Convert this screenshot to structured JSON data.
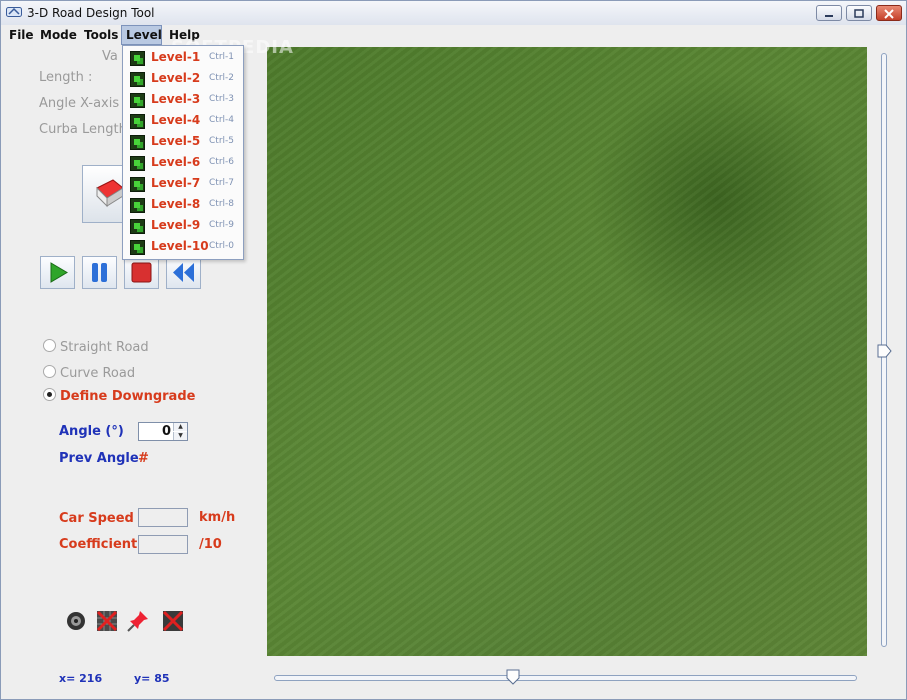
{
  "window": {
    "title": "3-D Road Design Tool"
  },
  "menu": {
    "items": [
      "File",
      "Mode",
      "Tools",
      "Level",
      "Help"
    ],
    "active": "Level"
  },
  "level_menu": [
    {
      "label": "Level-1",
      "shortcut": "Ctrl-1"
    },
    {
      "label": "Level-2",
      "shortcut": "Ctrl-2"
    },
    {
      "label": "Level-3",
      "shortcut": "Ctrl-3"
    },
    {
      "label": "Level-4",
      "shortcut": "Ctrl-4"
    },
    {
      "label": "Level-5",
      "shortcut": "Ctrl-5"
    },
    {
      "label": "Level-6",
      "shortcut": "Ctrl-6"
    },
    {
      "label": "Level-7",
      "shortcut": "Ctrl-7"
    },
    {
      "label": "Level-8",
      "shortcut": "Ctrl-8"
    },
    {
      "label": "Level-9",
      "shortcut": "Ctrl-9"
    },
    {
      "label": "Level-10",
      "shortcut": "Ctrl-0"
    }
  ],
  "left_panel": {
    "values_label": "Va",
    "length_label": "Length :",
    "angle_x_label": "Angle X-axis :",
    "curba_length_label": "Curba Length",
    "road_types": [
      {
        "label": "Straight Road",
        "checked": false,
        "enabled": false
      },
      {
        "label": "Curve Road",
        "checked": false,
        "enabled": false
      },
      {
        "label": "Define Downgrade",
        "checked": true,
        "enabled": true
      }
    ],
    "angle_label": "Angle (°)",
    "angle_value": "0",
    "prev_angle_label": "Prev Angle",
    "prev_angle_value": "#",
    "car_speed_label": "Car Speed",
    "car_speed_unit": "km/h",
    "car_speed_value": "",
    "coefficient_label": "Coefficient",
    "coefficient_unit": "/10",
    "coefficient_value": "",
    "coords": {
      "x": "x= 216",
      "y": "y= 85"
    }
  },
  "playback": [
    "play-icon",
    "pause-icon",
    "stop-icon",
    "rewind-icon"
  ],
  "tools": [
    "speaker-icon",
    "grid-delete-icon",
    "pin-icon",
    "clear-icon"
  ],
  "sliders": {
    "vertical_level": 0.5,
    "horizontal_level": 0.41
  },
  "watermark": "SOFTPEDIA",
  "colors": {
    "accent_red": "#d73b1c",
    "accent_blue": "#1f32b8",
    "terrain": "#547f33"
  }
}
